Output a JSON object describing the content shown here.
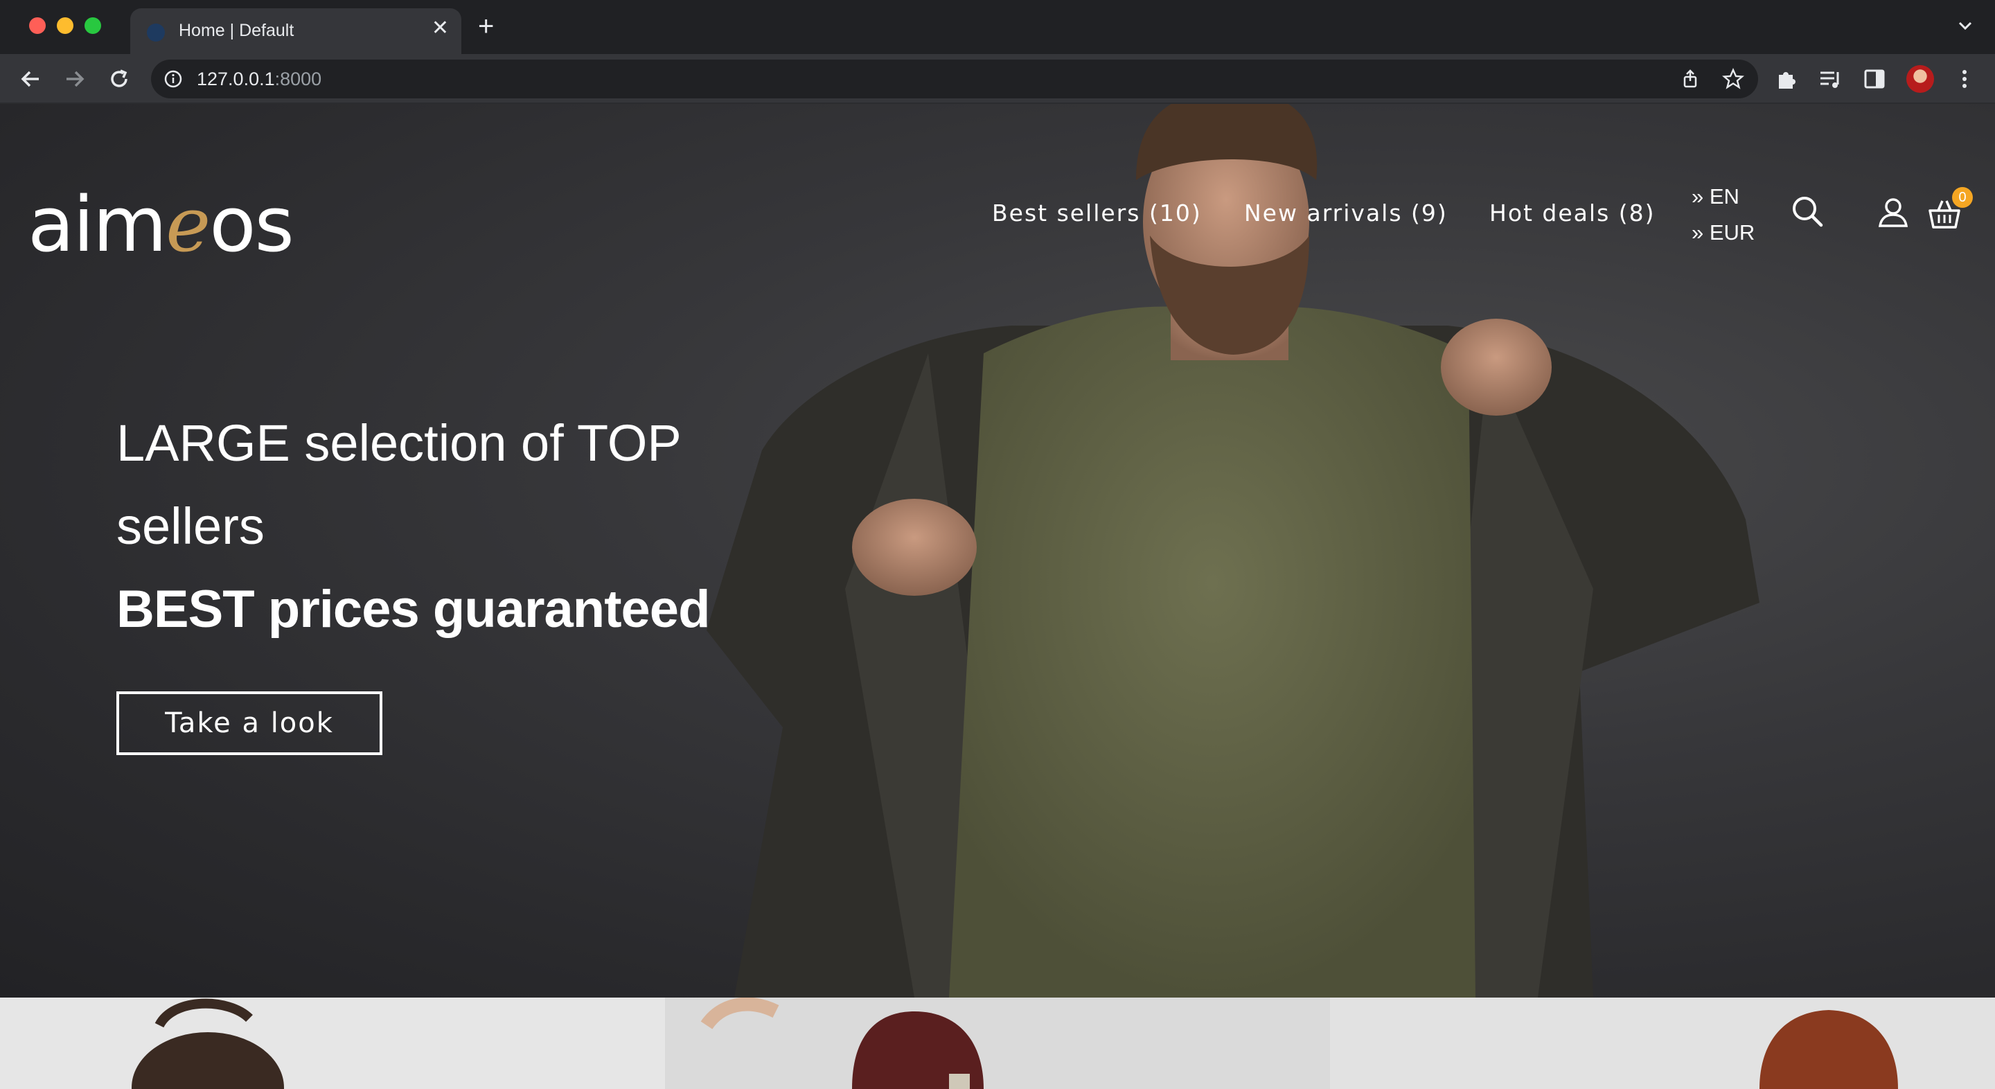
{
  "browser": {
    "tab": {
      "title": "Home | Default",
      "close_icon": "close-icon"
    },
    "new_tab_icon": "plus-icon",
    "url": {
      "host": "127.0.0.1",
      "port": ":8000"
    }
  },
  "header": {
    "logo": {
      "prefix": "aim",
      "accent": "e",
      "suffix": "os"
    },
    "nav": [
      {
        "label": "Best sellers (10)"
      },
      {
        "label": "New arrivals (9)"
      },
      {
        "label": "Hot deals (8)"
      }
    ],
    "locale": {
      "language": "» EN",
      "currency": "» EUR"
    },
    "basket_count": "0"
  },
  "hero": {
    "headline_line1": "LARGE selection of TOP",
    "headline_line2": "sellers",
    "headline_line3": "BEST prices guaranteed",
    "cta_label": "Take a look"
  },
  "colors": {
    "logo_accent": "#c79a55",
    "basket_badge": "#f5a623",
    "chrome_bg": "#202124",
    "toolbar_bg": "#35363a"
  }
}
